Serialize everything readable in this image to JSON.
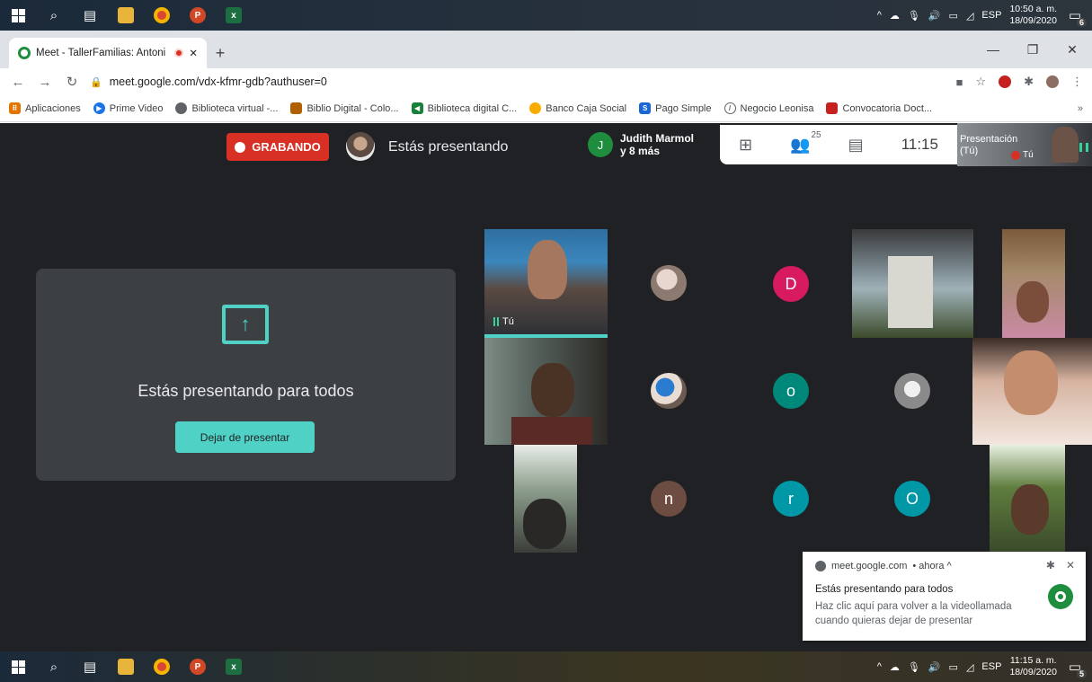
{
  "taskbar_top": {
    "time": "10:50 a. m.",
    "date": "18/09/2020",
    "lang": "ESP",
    "notifications": "6"
  },
  "taskbar_bottom": {
    "time": "11:15 a. m.",
    "date": "18/09/2020",
    "lang": "ESP",
    "notifications": "5"
  },
  "browser": {
    "tab_title": "Meet - TallerFamilias: Antoni",
    "new_tab": "+",
    "url": "meet.google.com/vdx-kfmr-gdb?authuser=0",
    "bookmarks": [
      {
        "label": "Aplicaciones",
        "color": "#e37400"
      },
      {
        "label": "Prime Video",
        "color": "#1a73e8"
      },
      {
        "label": "Biblioteca virtual -...",
        "color": "#5f6368"
      },
      {
        "label": "Biblio Digital - Colo...",
        "color": "#b06000"
      },
      {
        "label": "Biblioteca digital C...",
        "color": "#188038"
      },
      {
        "label": "Banco Caja Social",
        "color": "#f9ab00"
      },
      {
        "label": "Pago Simple",
        "color": "#1967d2"
      },
      {
        "label": "Negocio Leonisa",
        "color": "#5f6368"
      },
      {
        "label": "Convocatoria Doct...",
        "color": "#c5221f"
      }
    ],
    "bookmarks_more": "»"
  },
  "meet": {
    "recording_label": "GRABANDO",
    "presenting_label": "Estás presentando",
    "top_participant_initial": "J",
    "top_participant_name": "Judith Marmol",
    "top_participant_more": "y 8 más",
    "participant_count": "25",
    "clock": "11:15",
    "self_view_label_1": "Presentación",
    "self_view_label_2": "(Tú)",
    "self_view_name": "Tú",
    "present_card_title": "Estás presentando para todos",
    "stop_presenting_button": "Dejar de presentar",
    "tile_self_label": "Tú",
    "avatar_letters": {
      "d": "D",
      "o1": "o",
      "n": "n",
      "r": "r",
      "o2": "O"
    }
  },
  "notification": {
    "source": "meet.google.com",
    "time": "• ahora ^",
    "title": "Estás presentando para todos",
    "body": "Haz clic aquí para volver a la videollamada cuando quieras dejar de presentar"
  },
  "colors": {
    "accent_teal": "#4fd1c5",
    "recording_red": "#d93025",
    "meet_bg": "#202124"
  }
}
